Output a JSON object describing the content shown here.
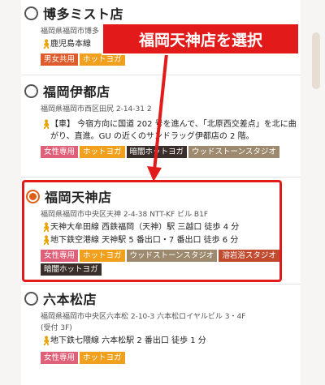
{
  "annotation": {
    "callout": "福岡天神店を選択",
    "color": "#e31a1a"
  },
  "stores": [
    {
      "name": "博多ミスト店",
      "address": "福岡県福岡市博多",
      "access": [
        "鹿児島本線"
      ],
      "tags": [
        "男女共用",
        "ホットヨガ"
      ],
      "selected": false
    },
    {
      "name": "福岡伊都店",
      "address": "福岡県福岡市西区田尻 2-14-31 2",
      "access": [
        "【車】 今宿方向に国道 202 号を進んで、「北原西交差点」を北に曲がり、直進。GU の近くのサンドラッグ伊都店の 2 階。"
      ],
      "tags": [
        "女性専用",
        "ホットヨガ",
        "暗闇ホットヨガ",
        "ウッドストーンスタジオ"
      ],
      "selected": false
    },
    {
      "name": "福岡天神店",
      "address": "福岡県福岡市中央区天神 2-4-38 NTT-KF ビル B1F",
      "access": [
        "天神大牟田線 西鉄福岡（天神）駅 三越口 徒歩 4 分",
        "地下鉄空港線 天神駅 5 番出口・7 番出口 徒歩 6 分"
      ],
      "tags": [
        "女性専用",
        "ホットヨガ",
        "ウッドストーンスタジオ",
        "溶岩浴スタジオ",
        "暗闇ホットヨガ"
      ],
      "selected": true
    },
    {
      "name": "六本松店",
      "address": "福岡県福岡市中央区六本松 2-10-3 六本松ロイヤルビル 3・4F",
      "address2": "(受付 3F)",
      "access": [
        "地下鉄七隈線 六本松駅 2 番出口 徒歩 1 分"
      ],
      "tags": [
        "女性専用",
        "ホットヨガ"
      ],
      "selected": false
    }
  ]
}
